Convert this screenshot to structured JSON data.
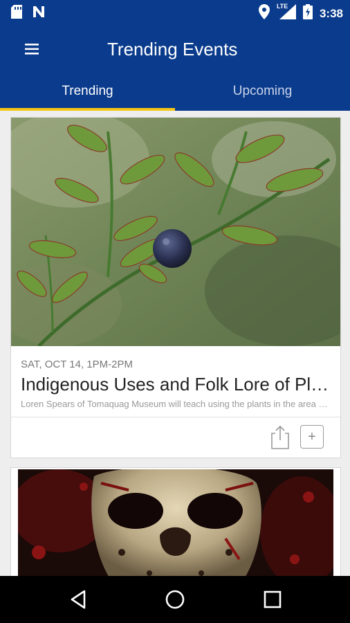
{
  "status_bar": {
    "time": "3:38",
    "network": "LTE",
    "icons": [
      "sd-card-icon",
      "n-notification-icon",
      "location-icon",
      "signal-icon",
      "battery-charging-icon"
    ]
  },
  "app_bar": {
    "title": "Trending Events",
    "menu_icon": "hamburger-menu-icon"
  },
  "tabs": [
    {
      "label": "Trending",
      "active": true
    },
    {
      "label": "Upcoming",
      "active": false
    }
  ],
  "events": [
    {
      "date": "SAT, OCT 14, 1PM-2PM",
      "title": "Indigenous Uses and Folk Lore of Plants",
      "description": "Loren Spears of Tomaquag Museum will teach using the plants in the area around us",
      "image": "blueberry-branch-photo",
      "actions": [
        "share-icon",
        "add-icon"
      ],
      "add_label": "+"
    },
    {
      "image": "hockey-mask-horror-photo"
    }
  ],
  "colors": {
    "primary": "#0a3b8c",
    "tab_indicator": "#f5c518",
    "inactive_tab_text": "#c9d4ea"
  },
  "nav_bar": {
    "buttons": [
      "back-icon",
      "home-icon",
      "recents-icon"
    ]
  }
}
